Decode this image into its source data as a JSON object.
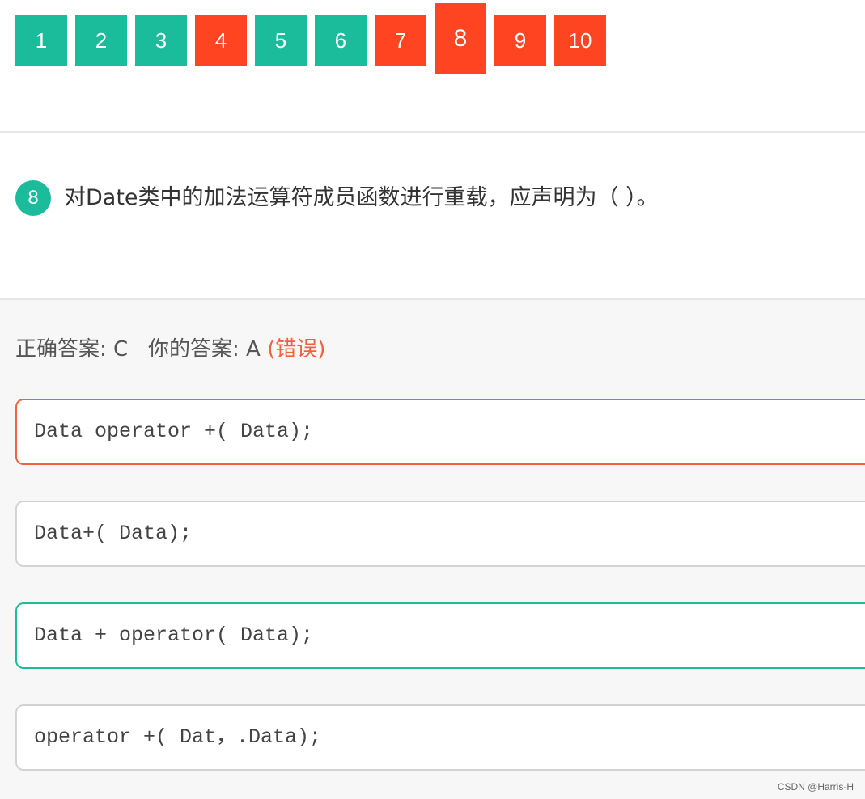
{
  "nav": {
    "questions": [
      {
        "label": "1",
        "state": "ok"
      },
      {
        "label": "2",
        "state": "ok"
      },
      {
        "label": "3",
        "state": "ok"
      },
      {
        "label": "4",
        "state": "bad"
      },
      {
        "label": "5",
        "state": "ok"
      },
      {
        "label": "6",
        "state": "ok"
      },
      {
        "label": "7",
        "state": "bad"
      },
      {
        "label": "8",
        "state": "bad",
        "current": true
      },
      {
        "label": "9",
        "state": "bad"
      },
      {
        "label": "10",
        "state": "bad"
      }
    ]
  },
  "question": {
    "number": "8",
    "text": "对Date类中的加法运算符成员函数进行重载，应声明为（    ）。"
  },
  "result": {
    "correct_label": "正确答案: C",
    "yours_label": "你的答案: A",
    "verdict": "(错误)"
  },
  "options": [
    {
      "text": "Data operator +( Data);",
      "state": "chosen"
    },
    {
      "text": "Data+( Data);",
      "state": "normal"
    },
    {
      "text": "Data + operator( Data);",
      "state": "correct"
    },
    {
      "text": "operator +( Dat，.Data);",
      "state": "normal"
    }
  ],
  "watermark": "CSDN @Harris-H",
  "colors": {
    "green": "#1abc9c",
    "red": "#ff4422",
    "wrong_text": "#f2603f"
  }
}
